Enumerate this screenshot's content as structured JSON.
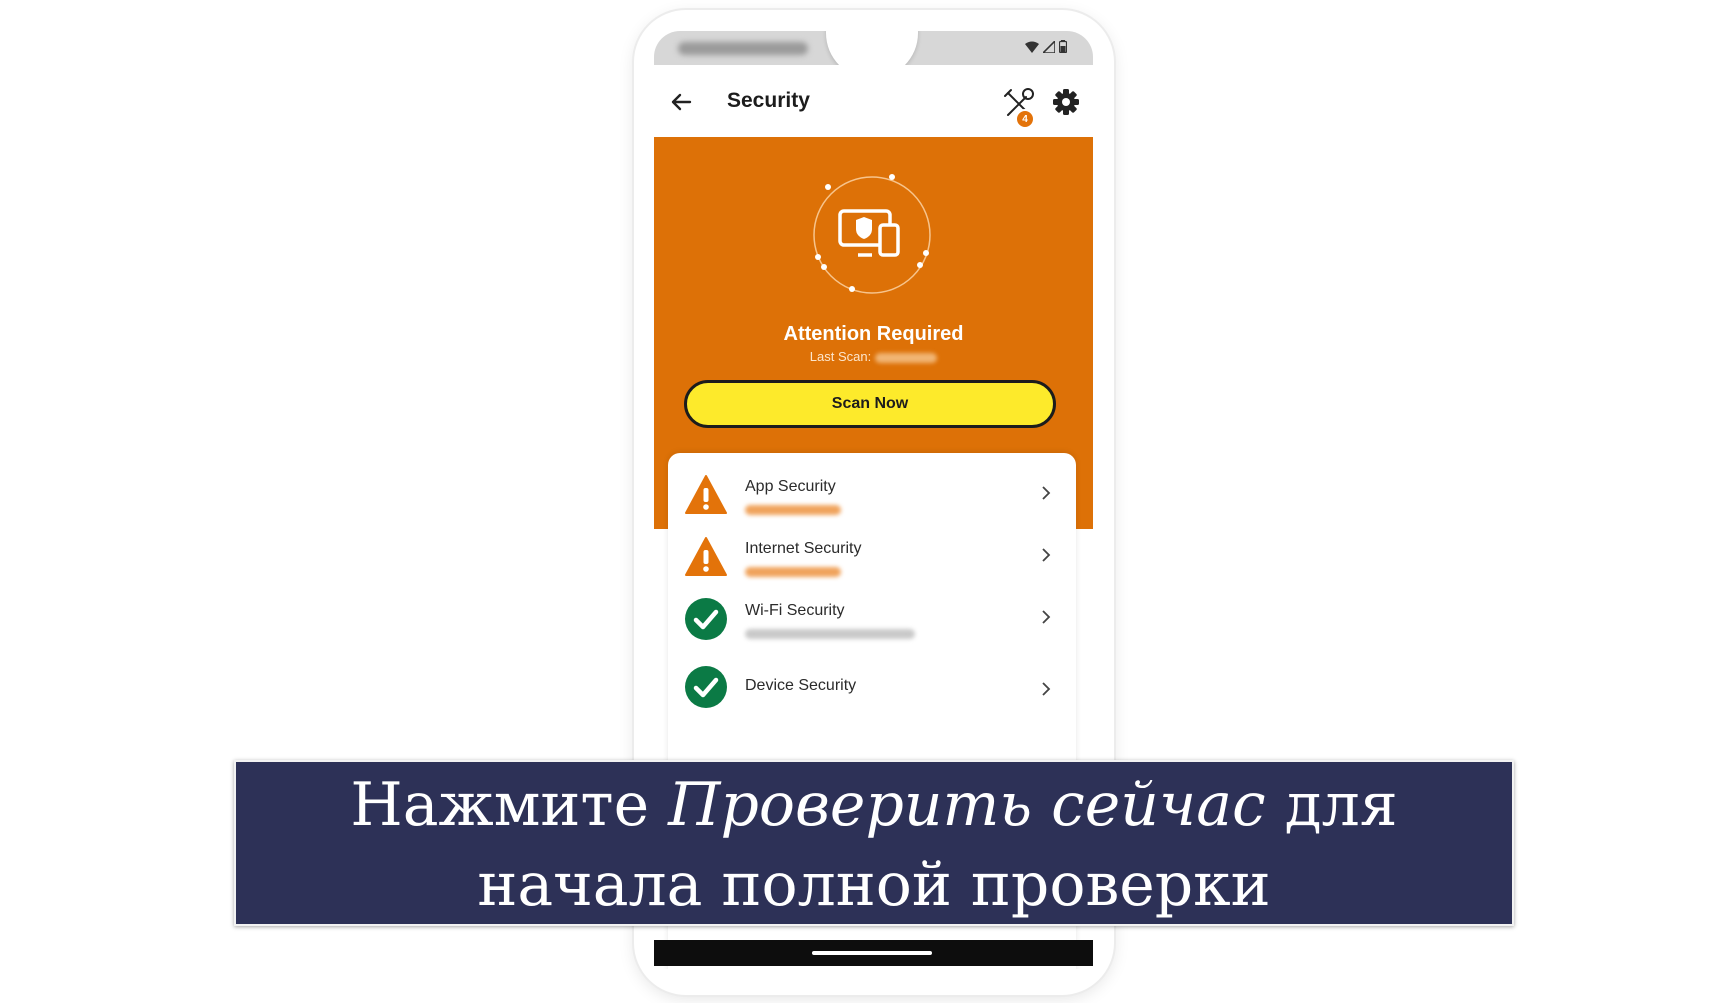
{
  "appbar": {
    "title": "Security",
    "tools_badge": "4"
  },
  "hero": {
    "status_title": "Attention Required",
    "last_scan_label": "Last Scan:",
    "scan_button_label": "Scan Now"
  },
  "security_items": [
    {
      "label": "App Security",
      "status": "warning",
      "icon": "warning-icon"
    },
    {
      "label": "Internet Security",
      "status": "warning",
      "icon": "warning-icon"
    },
    {
      "label": "Wi-Fi Security",
      "status": "ok",
      "icon": "check-circle-icon"
    },
    {
      "label": "Device Security",
      "status": "ok",
      "icon": "check-circle-icon"
    }
  ],
  "caption": {
    "before": "Нажмите ",
    "emphasis": "Проверить сейчас",
    "after": " для начала полной проверки"
  },
  "colors": {
    "accent_orange": "#dd7107",
    "scan_yellow": "#fdea2b",
    "ok_green": "#0b7a45",
    "caption_bg": "#2d3157"
  }
}
